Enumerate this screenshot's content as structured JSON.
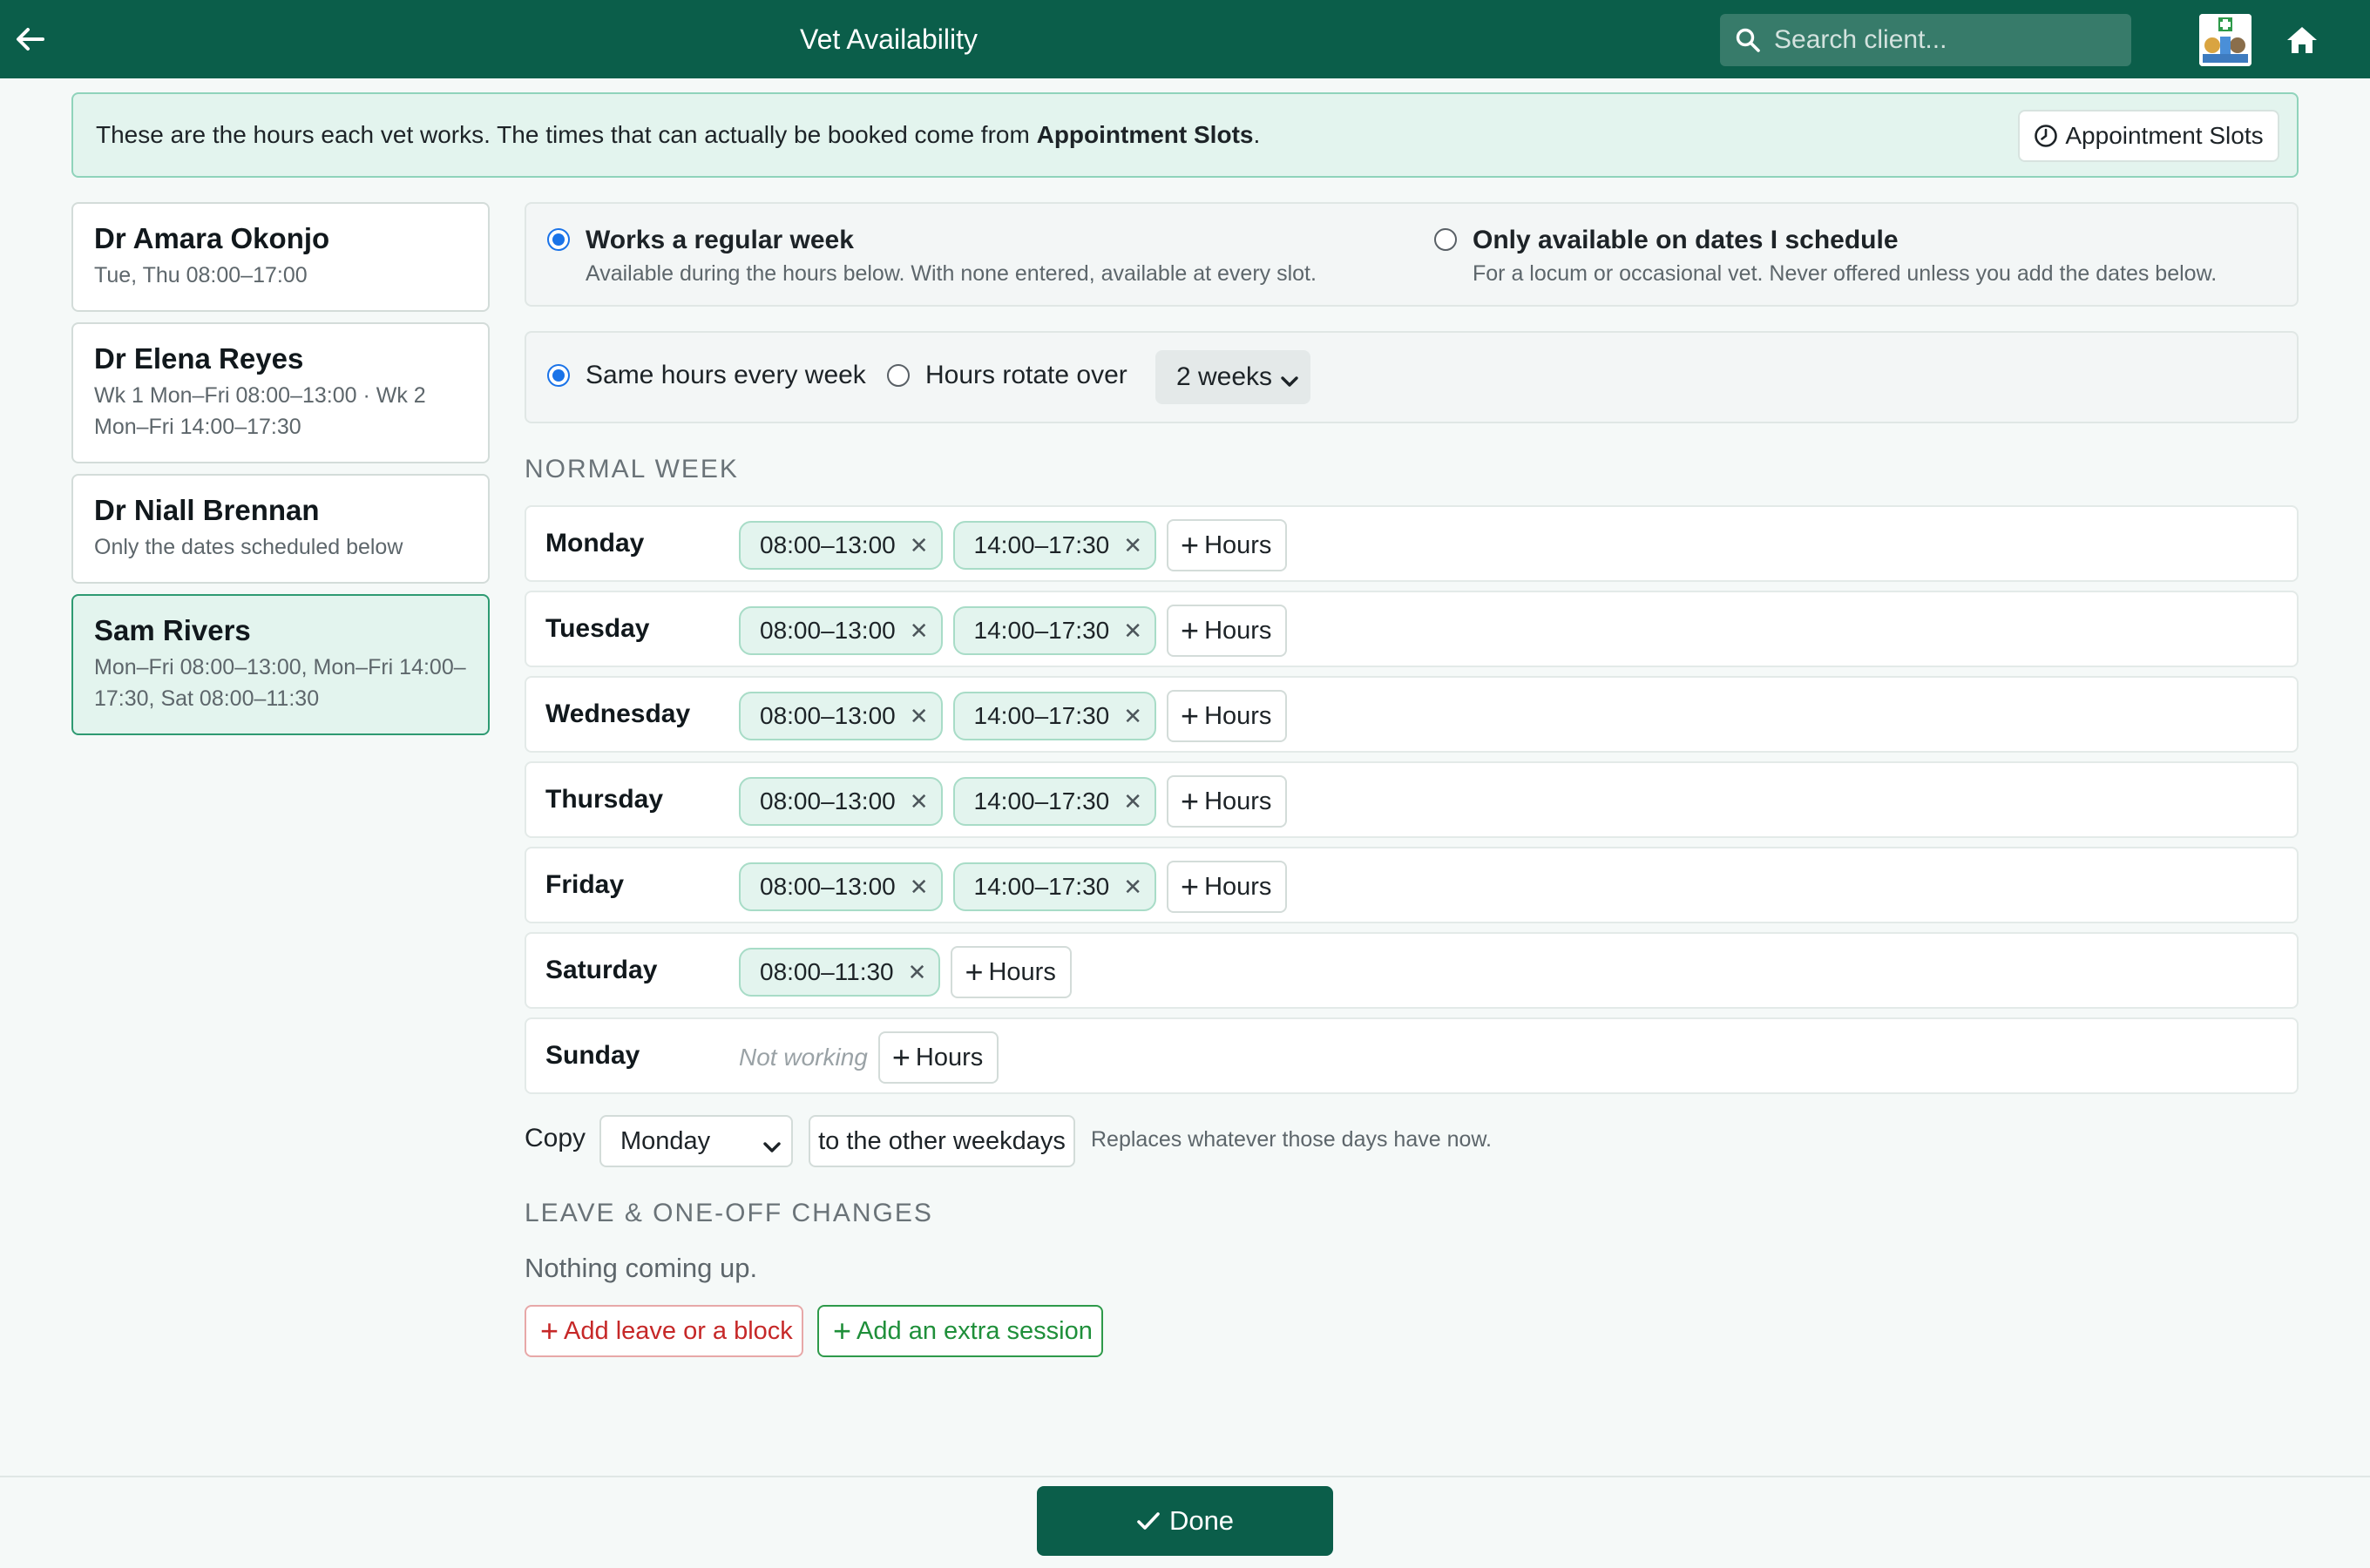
{
  "header": {
    "title": "Vet Availability",
    "search_placeholder": "Search client...",
    "back_icon": "arrow-left-icon",
    "home_icon": "home-icon",
    "accent": "#0b5e4a"
  },
  "banner": {
    "text_before": "These are the hours each vet works. The times that can actually be booked come from ",
    "text_bold": "Appointment Slots",
    "text_after": ".",
    "button_label": "Appointment Slots"
  },
  "vets": [
    {
      "name": "Dr Amara Okonjo",
      "summary": "Tue, Thu 08:00–17:00",
      "selected": false
    },
    {
      "name": "Dr Elena Reyes",
      "summary": "Wk 1 Mon–Fri 08:00–13:00 · Wk 2 Mon–Fri 14:00–17:30",
      "selected": false
    },
    {
      "name": "Dr Niall Brennan",
      "summary": "Only the dates scheduled below",
      "selected": false
    },
    {
      "name": "Sam Rivers",
      "summary": "Mon–Fri 08:00–13:00, Mon–Fri 14:00–17:30, Sat 08:00–11:30",
      "selected": true
    }
  ],
  "mode": {
    "regular": {
      "title": "Works a regular week",
      "desc": "Available during the hours below. With none entered, available at every slot.",
      "selected": true
    },
    "scheduled": {
      "title": "Only available on dates I schedule",
      "desc": "For a locum or occasional vet. Never offered unless you add the dates below.",
      "selected": false
    }
  },
  "rotation": {
    "same_label": "Same hours every week",
    "rotate_label": "Hours rotate over",
    "same_selected": true,
    "weeks_value": "2 weeks"
  },
  "normal_week": {
    "heading": "Normal week",
    "add_label": "Hours",
    "not_working_label": "Not working",
    "days": [
      {
        "name": "Monday",
        "ranges": [
          "08:00–13:00",
          "14:00–17:30"
        ]
      },
      {
        "name": "Tuesday",
        "ranges": [
          "08:00–13:00",
          "14:00–17:30"
        ]
      },
      {
        "name": "Wednesday",
        "ranges": [
          "08:00–13:00",
          "14:00–17:30"
        ]
      },
      {
        "name": "Thursday",
        "ranges": [
          "08:00–13:00",
          "14:00–17:30"
        ]
      },
      {
        "name": "Friday",
        "ranges": [
          "08:00–13:00",
          "14:00–17:30"
        ]
      },
      {
        "name": "Saturday",
        "ranges": [
          "08:00–11:30"
        ]
      },
      {
        "name": "Sunday",
        "ranges": []
      }
    ]
  },
  "copy": {
    "label": "Copy",
    "day_value": "Monday",
    "button_label": "to the other weekdays",
    "note": "Replaces whatever those days have now."
  },
  "leave": {
    "heading": "Leave & one-off changes",
    "empty_text": "Nothing coming up.",
    "add_leave_label": "Add leave or a block",
    "add_extra_label": "Add an extra session"
  },
  "footer": {
    "done_label": "Done"
  }
}
